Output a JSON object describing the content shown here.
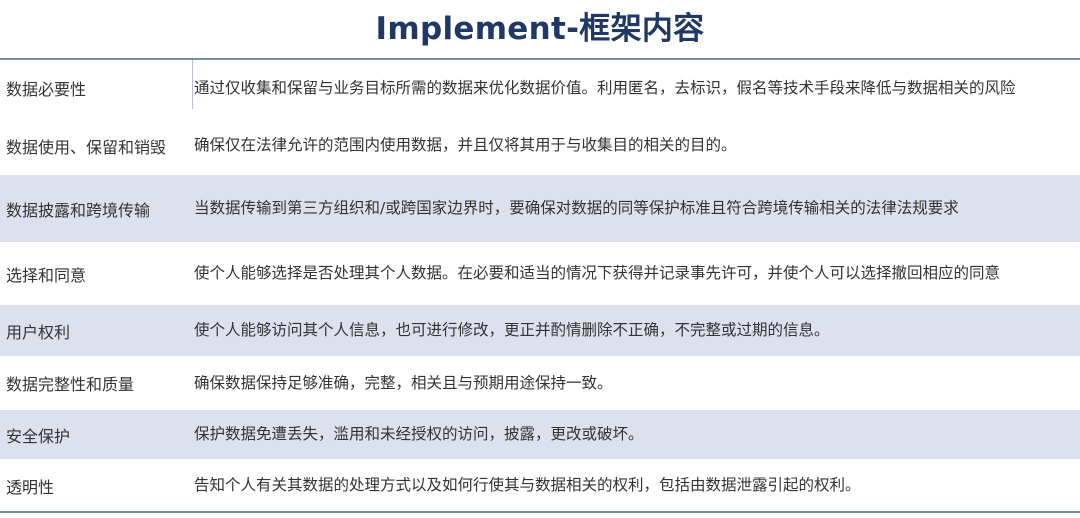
{
  "title": "Implement-框架内容",
  "rows": [
    {
      "name": "数据必要性",
      "description": "通过仅收集和保留与业务目标所需的数据来优化数据价值。利用匿名，去标识，假名等技术手段来降低与数据相关的风险"
    },
    {
      "name": "数据使用、保留和销毁",
      "description": "确保仅在法律允许的范围内使用数据，并且仅将其用于与收集目的相关的目的。"
    },
    {
      "name": "数据披露和跨境传输",
      "description": "当数据传输到第三方组织和/或跨国家边界时，要确保对数据的同等保护标准且符合跨境传输相关的法律法规要求"
    },
    {
      "name": "选择和同意",
      "description": "使个人能够选择是否处理其个人数据。在必要和适当的情况下获得并记录事先许可，并使个人可以选择撤回相应的同意"
    },
    {
      "name": "用户权利",
      "description": "使个人能够访问其个人信息，也可进行修改，更正并酌情删除不正确，不完整或过期的信息。"
    },
    {
      "name": "数据完整性和质量",
      "description": "确保数据保持足够准确，完整，相关且与预期用途保持一致。"
    },
    {
      "name": "安全保护",
      "description": "保护数据免遭丢失，滥用和未经授权的访问，披露，更改或破坏。"
    },
    {
      "name": "透明性",
      "description": "告知个人有关其数据的处理方式以及如何行使其与数据相关的权利，包括由数据泄露引起的权利。"
    }
  ]
}
